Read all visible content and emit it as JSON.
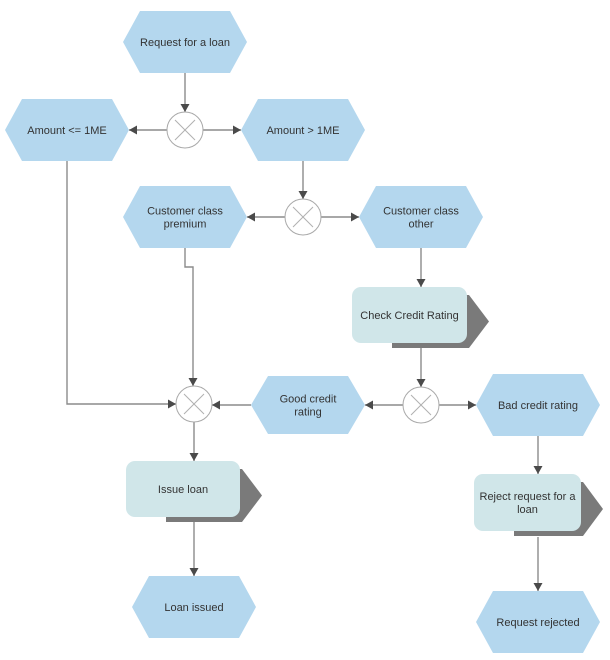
{
  "diagram": {
    "type": "event-driven process chain",
    "colors": {
      "event": "#b4d7ee",
      "function": "#d0e6e9",
      "function_shadow": "#7a7a7a",
      "connector": "#a9a9a9",
      "edge": "#8c8c8c",
      "text": "#333333"
    },
    "events": [
      {
        "id": "e_request",
        "lines": [
          "Request for a loan"
        ]
      },
      {
        "id": "e_amount_le",
        "lines": [
          "Amount <= 1ME"
        ]
      },
      {
        "id": "e_amount_gt",
        "lines": [
          "Amount > 1ME"
        ]
      },
      {
        "id": "e_premium",
        "lines": [
          "Customer class",
          "premium"
        ]
      },
      {
        "id": "e_other",
        "lines": [
          "Customer class",
          "other"
        ]
      },
      {
        "id": "e_good",
        "lines": [
          "Good credit",
          "rating"
        ]
      },
      {
        "id": "e_bad",
        "lines": [
          "Bad credit rating"
        ]
      },
      {
        "id": "e_issued",
        "lines": [
          "Loan issued"
        ]
      },
      {
        "id": "e_rejected",
        "lines": [
          "Request rejected"
        ]
      }
    ],
    "functions": [
      {
        "id": "f_check",
        "lines": [
          "Check Credit Rating"
        ]
      },
      {
        "id": "f_issue",
        "lines": [
          "Issue loan"
        ]
      },
      {
        "id": "f_reject",
        "lines": [
          "Reject request for a",
          "loan"
        ]
      }
    ],
    "connectors": [
      {
        "id": "x1",
        "kind": "XOR"
      },
      {
        "id": "x2",
        "kind": "XOR"
      },
      {
        "id": "x3",
        "kind": "XOR"
      },
      {
        "id": "x4",
        "kind": "XOR"
      }
    ],
    "edges": [
      {
        "from": "e_request",
        "to": "x1"
      },
      {
        "from": "x1",
        "to": "e_amount_le"
      },
      {
        "from": "x1",
        "to": "e_amount_gt"
      },
      {
        "from": "e_amount_gt",
        "to": "x2"
      },
      {
        "from": "x2",
        "to": "e_premium"
      },
      {
        "from": "x2",
        "to": "e_other"
      },
      {
        "from": "e_other",
        "to": "f_check"
      },
      {
        "from": "f_check",
        "to": "x3"
      },
      {
        "from": "x3",
        "to": "e_good"
      },
      {
        "from": "x3",
        "to": "e_bad"
      },
      {
        "from": "e_amount_le",
        "to": "x4"
      },
      {
        "from": "e_premium",
        "to": "x4"
      },
      {
        "from": "e_good",
        "to": "x4"
      },
      {
        "from": "x4",
        "to": "f_issue"
      },
      {
        "from": "f_issue",
        "to": "e_issued"
      },
      {
        "from": "e_bad",
        "to": "f_reject"
      },
      {
        "from": "f_reject",
        "to": "e_rejected"
      }
    ]
  }
}
